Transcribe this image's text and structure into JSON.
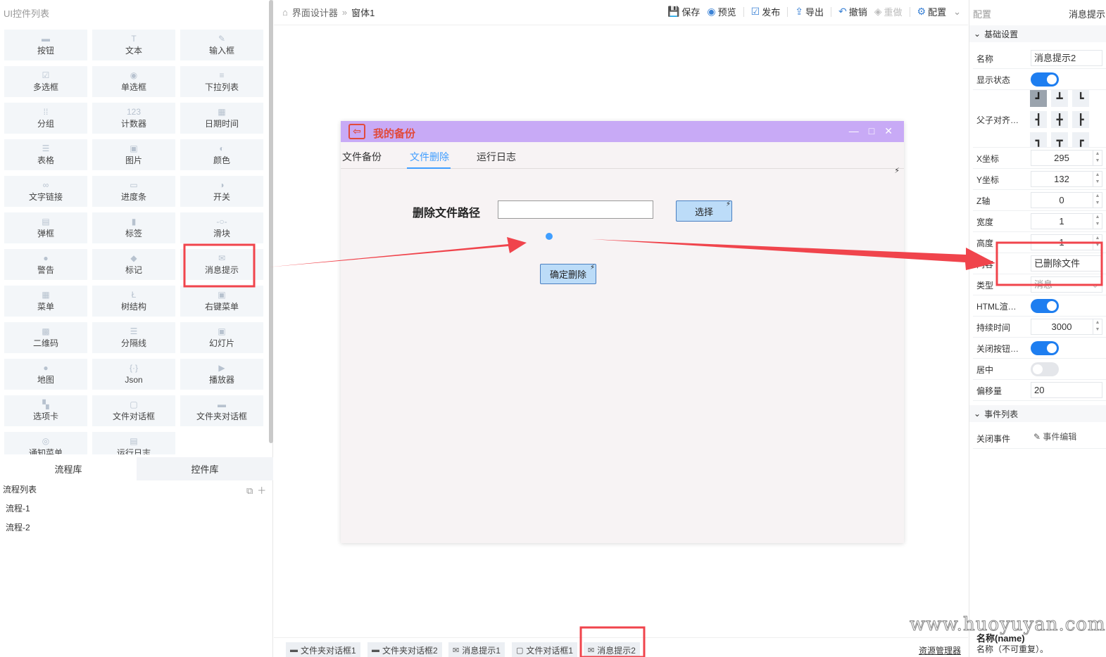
{
  "left_panel": {
    "title": "UI控件列表",
    "controls": [
      {
        "label": "按钮",
        "icon": "▬",
        "name": "button"
      },
      {
        "label": "文本",
        "icon": "T",
        "name": "text"
      },
      {
        "label": "输入框",
        "icon": "✎",
        "name": "input"
      },
      {
        "label": "多选框",
        "icon": "☑",
        "name": "checkbox"
      },
      {
        "label": "单选框",
        "icon": "◉",
        "name": "radio"
      },
      {
        "label": "下拉列表",
        "icon": "≡",
        "name": "dropdown"
      },
      {
        "label": "分组",
        "icon": "⁞⁞",
        "name": "group"
      },
      {
        "label": "计数器",
        "icon": "123",
        "name": "counter"
      },
      {
        "label": "日期时间",
        "icon": "▦",
        "name": "datetime"
      },
      {
        "label": "表格",
        "icon": "☰",
        "name": "table"
      },
      {
        "label": "图片",
        "icon": "▣",
        "name": "image"
      },
      {
        "label": "颜色",
        "icon": "◐",
        "name": "color"
      },
      {
        "label": "文字链接",
        "icon": "∞",
        "name": "text-link"
      },
      {
        "label": "进度条",
        "icon": "▭",
        "name": "progress"
      },
      {
        "label": "开关",
        "icon": "◑",
        "name": "switch"
      },
      {
        "label": "弹框",
        "icon": "▤",
        "name": "popup"
      },
      {
        "label": "标签",
        "icon": "▮",
        "name": "label"
      },
      {
        "label": "滑块",
        "icon": "-○-",
        "name": "slider"
      },
      {
        "label": "警告",
        "icon": "●",
        "name": "warning"
      },
      {
        "label": "标记",
        "icon": "◆",
        "name": "tag"
      },
      {
        "label": "消息提示",
        "icon": "✉",
        "name": "message"
      },
      {
        "label": "菜单",
        "icon": "▦",
        "name": "menu"
      },
      {
        "label": "树结构",
        "icon": "Ł",
        "name": "tree"
      },
      {
        "label": "右键菜单",
        "icon": "▣",
        "name": "context-menu"
      },
      {
        "label": "二维码",
        "icon": "▩",
        "name": "qrcode"
      },
      {
        "label": "分隔线",
        "icon": "☰",
        "name": "divider"
      },
      {
        "label": "幻灯片",
        "icon": "▣",
        "name": "slideshow"
      },
      {
        "label": "地图",
        "icon": "●",
        "name": "map"
      },
      {
        "label": "Json",
        "icon": "{·}",
        "name": "json"
      },
      {
        "label": "播放器",
        "icon": "▶",
        "name": "player"
      },
      {
        "label": "选项卡",
        "icon": "▚",
        "name": "tabs"
      },
      {
        "label": "文件对话框",
        "icon": "▢",
        "name": "file-dialog"
      },
      {
        "label": "文件夹对话框",
        "icon": "▬",
        "name": "folder-dialog"
      },
      {
        "label": "通知菜单",
        "icon": "◎",
        "name": "notify-menu"
      },
      {
        "label": "运行日志",
        "icon": "▤",
        "name": "run-log"
      }
    ],
    "lib_tabs": [
      "流程库",
      "控件库"
    ],
    "flow_list_title": "流程列表",
    "flow_tools": "⧉＋",
    "flows": [
      "流程-1",
      "流程-2"
    ]
  },
  "toolbar": {
    "breadcrumb": [
      "界面设计器",
      "窗体1"
    ],
    "buttons": [
      {
        "label": "保存",
        "icon": "💾"
      },
      {
        "label": "预览",
        "icon": "◉"
      },
      {
        "label": "发布",
        "icon": "☑"
      },
      {
        "label": "导出",
        "icon": "⇪"
      },
      {
        "label": "撤销",
        "icon": "↶"
      },
      {
        "label": "重做",
        "icon": "◈"
      },
      {
        "label": "配置",
        "icon": "⚙"
      }
    ],
    "more": "⌄"
  },
  "design_window": {
    "title": "我的备份",
    "logo": "⇦",
    "win_controls": [
      "—",
      "□",
      "✕"
    ],
    "tabs": [
      "文件备份",
      "文件删除",
      "运行日志"
    ],
    "active_tab": "文件删除",
    "path_label": "删除文件路径",
    "path_value": "",
    "select_btn": "选择",
    "confirm_btn": "确定删除",
    "bolt": "⚡",
    "accent_color": "#409eff",
    "title_bg": "#c8aaf6",
    "title_color": "#e14a3b"
  },
  "bottom_tabs": [
    {
      "label": "文件夹对话框1",
      "icon": "▬"
    },
    {
      "label": "文件夹对话框2",
      "icon": "▬"
    },
    {
      "label": "消息提示1",
      "icon": "✉"
    },
    {
      "label": "文件对话框1",
      "icon": "▢"
    },
    {
      "label": "消息提示2",
      "icon": "✉"
    }
  ],
  "resource_manager": "资源管理器",
  "right_panel": {
    "header_title": "配置",
    "header_value": "消息提示",
    "basic_section": "基础设置",
    "events_section": "事件列表",
    "props": {
      "name_label": "名称",
      "name_value": "消息提示2",
      "visible_label": "显示状态",
      "visible": true,
      "align_label": "父子对齐…",
      "x_label": "X坐标",
      "x_value": "295",
      "y_label": "Y坐标",
      "y_value": "132",
      "z_label": "Z轴",
      "z_value": "0",
      "w_label": "宽度",
      "w_value": "1",
      "h_label": "高度",
      "h_value": "1",
      "content_label": "内容",
      "content_value": "已删除文件",
      "type_label": "类型",
      "type_value": "消息",
      "html_label": "HTML渲…",
      "html": true,
      "duration_label": "持续时间",
      "duration_value": "3000",
      "close_label": "关闭按钮…",
      "close": true,
      "center_label": "居中",
      "center": false,
      "offset_label": "偏移量",
      "offset_value": "20"
    },
    "align_cells": [
      "┛",
      "┻",
      "┗",
      "┫",
      "╋",
      "┣",
      "┓",
      "┳",
      "┏"
    ],
    "event_label": "关闭事件",
    "event_value": "✎ 事件编辑",
    "help_title": "名称(name)",
    "help_text": "名称（不可重复）。"
  },
  "watermark": "www.huoyuyan.com",
  "annotation_color": "#f0444c"
}
